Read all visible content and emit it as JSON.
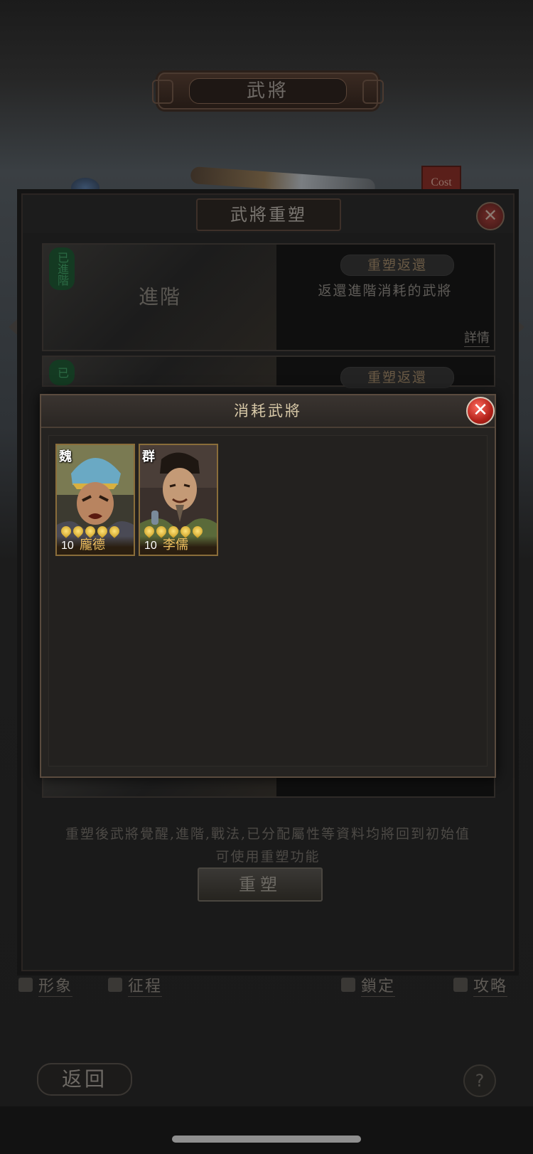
{
  "screen": {
    "top_title": "武將",
    "cost_tag": "Cost"
  },
  "main_modal": {
    "title": "武將重塑",
    "close_icon": "close-icon",
    "cards": [
      {
        "image_label": "進階",
        "seal": "已進階",
        "button": "重塑返還",
        "description": "返還進階消耗的武將",
        "detail": "詳情"
      },
      {
        "seal": "已",
        "button": "重塑返還"
      }
    ],
    "footer_text_1": "重塑後武將覺醒,進階,戰法,已分配屬性等資料均將回到初始值",
    "footer_text_2": "可使用重塑功能",
    "rebuild_button": "重塑"
  },
  "toolbar": {
    "items": [
      {
        "label": "形象",
        "icon": "person-icon"
      },
      {
        "label": "征程",
        "icon": "flag-icon"
      },
      {
        "label": "鎖定",
        "icon": "lock-icon"
      },
      {
        "label": "攻略",
        "icon": "book-icon"
      }
    ],
    "back_button": "返回",
    "help_button": "?"
  },
  "popup": {
    "title": "消耗武將",
    "heroes": [
      {
        "faction": "魏",
        "level": "10",
        "name": "龐德",
        "stars": 5
      },
      {
        "faction": "群",
        "level": "10",
        "name": "李儒",
        "stars": 5
      }
    ]
  },
  "colors": {
    "accent_gold": "#d8c9a8",
    "close_red": "#b3221a",
    "name_gold": "#f0c060"
  }
}
